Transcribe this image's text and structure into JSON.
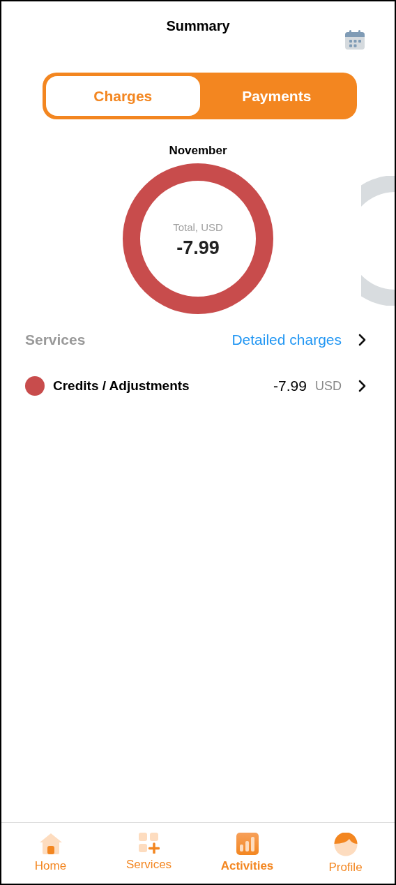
{
  "header": {
    "title": "Summary"
  },
  "tabs": [
    {
      "label": "Charges",
      "selected": true
    },
    {
      "label": "Payments",
      "selected": false
    }
  ],
  "period": {
    "month": "November",
    "total_label": "Total, USD",
    "total": "-7.99"
  },
  "services": {
    "title": "Services",
    "link": "Detailed charges",
    "items": [
      {
        "name": "Credits / Adjustments",
        "amount": "-7.99",
        "currency": "USD",
        "color": "#c84c4c"
      }
    ]
  },
  "nav": [
    {
      "label": "Home",
      "kind": "home",
      "selected": false
    },
    {
      "label": "Services",
      "kind": "services",
      "selected": false
    },
    {
      "label": "Activities",
      "kind": "activities",
      "selected": true
    },
    {
      "label": "Profile",
      "kind": "profile",
      "selected": false
    }
  ]
}
